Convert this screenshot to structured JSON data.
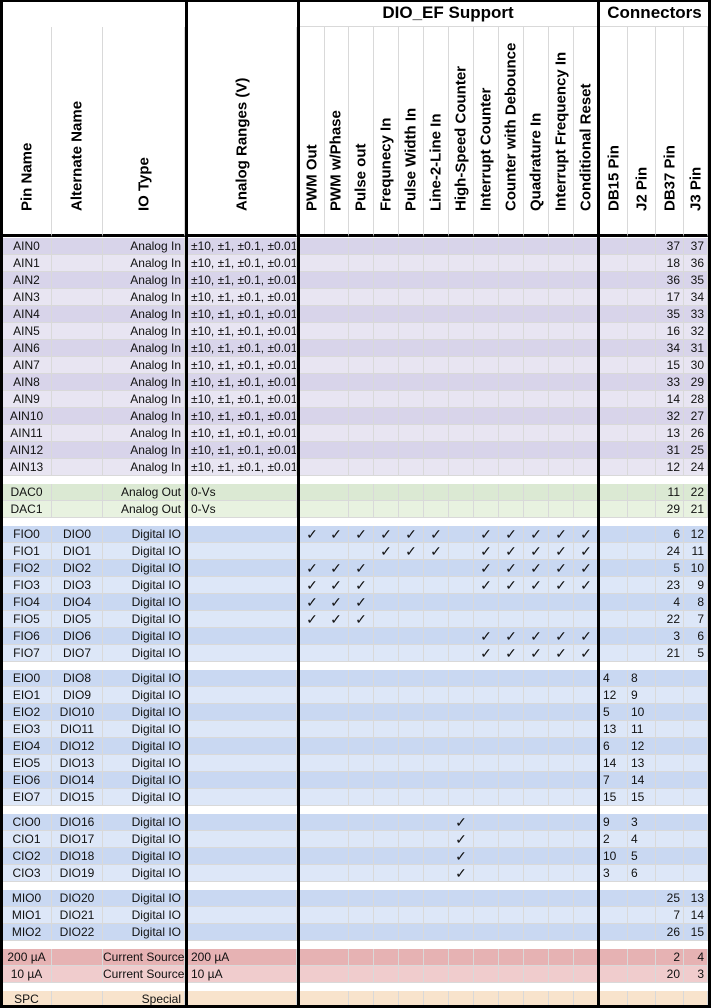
{
  "group_headers": {
    "dio_ef": "DIO_EF Support",
    "connectors": "Connectors"
  },
  "columns": {
    "pin_name": "Pin Name",
    "alternate_name": "Alternate Name",
    "io_type": "IO Type",
    "analog_ranges": "Analog Ranges (V)",
    "dio_ef": [
      "PWM Out",
      "PWM w/Phase",
      "Pulse out",
      "Frequnecy In",
      "Pulse Width In",
      "Line-2-Line In",
      "High-Speed Counter",
      "Interrupt Counter",
      "Counter with Debounce",
      "Quadrature In",
      "Interrupt Frequency In",
      "Conditional Reset"
    ],
    "connectors": [
      "DB15 Pin",
      "J2 Pin",
      "DB37 Pin",
      "J3 Pin"
    ]
  },
  "check_glyph": "✓",
  "colors": {
    "analog_in_dark": "#d8d4ea",
    "analog_in_light": "#e8e5f2",
    "analog_out_dark": "#dbe9d3",
    "analog_out_light": "#e8f2e0",
    "digital_dark": "#c9d8f2",
    "digital_light": "#dde7f8",
    "current_dark": "#e6b2b3",
    "current_light": "#f0cccd",
    "special": "#f8e3cc"
  },
  "groups": [
    {
      "color_key": "analog_in",
      "rows": [
        {
          "pin": "AIN0",
          "alt": "",
          "type": "Analog In",
          "range": "±10, ±1, ±0.1, ±0.01",
          "ef": [],
          "db15": "",
          "j2": "",
          "db37": "37",
          "j3": "37"
        },
        {
          "pin": "AIN1",
          "alt": "",
          "type": "Analog In",
          "range": "±10, ±1, ±0.1, ±0.01",
          "ef": [],
          "db15": "",
          "j2": "",
          "db37": "18",
          "j3": "36"
        },
        {
          "pin": "AIN2",
          "alt": "",
          "type": "Analog In",
          "range": "±10, ±1, ±0.1, ±0.01",
          "ef": [],
          "db15": "",
          "j2": "",
          "db37": "36",
          "j3": "35"
        },
        {
          "pin": "AIN3",
          "alt": "",
          "type": "Analog In",
          "range": "±10, ±1, ±0.1, ±0.01",
          "ef": [],
          "db15": "",
          "j2": "",
          "db37": "17",
          "j3": "34"
        },
        {
          "pin": "AIN4",
          "alt": "",
          "type": "Analog In",
          "range": "±10, ±1, ±0.1, ±0.01",
          "ef": [],
          "db15": "",
          "j2": "",
          "db37": "35",
          "j3": "33"
        },
        {
          "pin": "AIN5",
          "alt": "",
          "type": "Analog In",
          "range": "±10, ±1, ±0.1, ±0.01",
          "ef": [],
          "db15": "",
          "j2": "",
          "db37": "16",
          "j3": "32"
        },
        {
          "pin": "AIN6",
          "alt": "",
          "type": "Analog In",
          "range": "±10, ±1, ±0.1, ±0.01",
          "ef": [],
          "db15": "",
          "j2": "",
          "db37": "34",
          "j3": "31"
        },
        {
          "pin": "AIN7",
          "alt": "",
          "type": "Analog In",
          "range": "±10, ±1, ±0.1, ±0.01",
          "ef": [],
          "db15": "",
          "j2": "",
          "db37": "15",
          "j3": "30"
        },
        {
          "pin": "AIN8",
          "alt": "",
          "type": "Analog In",
          "range": "±10, ±1, ±0.1, ±0.01",
          "ef": [],
          "db15": "",
          "j2": "",
          "db37": "33",
          "j3": "29"
        },
        {
          "pin": "AIN9",
          "alt": "",
          "type": "Analog In",
          "range": "±10, ±1, ±0.1, ±0.01",
          "ef": [],
          "db15": "",
          "j2": "",
          "db37": "14",
          "j3": "28"
        },
        {
          "pin": "AIN10",
          "alt": "",
          "type": "Analog In",
          "range": "±10, ±1, ±0.1, ±0.01",
          "ef": [],
          "db15": "",
          "j2": "",
          "db37": "32",
          "j3": "27"
        },
        {
          "pin": "AIN11",
          "alt": "",
          "type": "Analog In",
          "range": "±10, ±1, ±0.1, ±0.01",
          "ef": [],
          "db15": "",
          "j2": "",
          "db37": "13",
          "j3": "26"
        },
        {
          "pin": "AIN12",
          "alt": "",
          "type": "Analog In",
          "range": "±10, ±1, ±0.1, ±0.01",
          "ef": [],
          "db15": "",
          "j2": "",
          "db37": "31",
          "j3": "25"
        },
        {
          "pin": "AIN13",
          "alt": "",
          "type": "Analog In",
          "range": "±10, ±1, ±0.1, ±0.01",
          "ef": [],
          "db15": "",
          "j2": "",
          "db37": "12",
          "j3": "24"
        }
      ]
    },
    {
      "color_key": "analog_out",
      "rows": [
        {
          "pin": "DAC0",
          "alt": "",
          "type": "Analog Out",
          "range": "0-Vs",
          "ef": [],
          "db15": "",
          "j2": "",
          "db37": "11",
          "j3": "22"
        },
        {
          "pin": "DAC1",
          "alt": "",
          "type": "Analog Out",
          "range": "0-Vs",
          "ef": [],
          "db15": "",
          "j2": "",
          "db37": "29",
          "j3": "21"
        }
      ]
    },
    {
      "color_key": "digital",
      "rows": [
        {
          "pin": "FIO0",
          "alt": "DIO0",
          "type": "Digital IO",
          "range": "",
          "ef": [
            0,
            1,
            2,
            3,
            4,
            5,
            7,
            8,
            9,
            10,
            11
          ],
          "db15": "",
          "j2": "",
          "db37": "6",
          "j3": "12"
        },
        {
          "pin": "FIO1",
          "alt": "DIO1",
          "type": "Digital IO",
          "range": "",
          "ef": [
            3,
            4,
            5,
            7,
            8,
            9,
            10,
            11
          ],
          "db15": "",
          "j2": "",
          "db37": "24",
          "j3": "11"
        },
        {
          "pin": "FIO2",
          "alt": "DIO2",
          "type": "Digital IO",
          "range": "",
          "ef": [
            0,
            1,
            2,
            7,
            8,
            9,
            10,
            11
          ],
          "db15": "",
          "j2": "",
          "db37": "5",
          "j3": "10"
        },
        {
          "pin": "FIO3",
          "alt": "DIO3",
          "type": "Digital IO",
          "range": "",
          "ef": [
            0,
            1,
            2,
            7,
            8,
            9,
            10,
            11
          ],
          "db15": "",
          "j2": "",
          "db37": "23",
          "j3": "9"
        },
        {
          "pin": "FIO4",
          "alt": "DIO4",
          "type": "Digital IO",
          "range": "",
          "ef": [
            0,
            1,
            2
          ],
          "db15": "",
          "j2": "",
          "db37": "4",
          "j3": "8"
        },
        {
          "pin": "FIO5",
          "alt": "DIO5",
          "type": "Digital IO",
          "range": "",
          "ef": [
            0,
            1,
            2
          ],
          "db15": "",
          "j2": "",
          "db37": "22",
          "j3": "7"
        },
        {
          "pin": "FIO6",
          "alt": "DIO6",
          "type": "Digital IO",
          "range": "",
          "ef": [
            7,
            8,
            9,
            10,
            11
          ],
          "db15": "",
          "j2": "",
          "db37": "3",
          "j3": "6"
        },
        {
          "pin": "FIO7",
          "alt": "DIO7",
          "type": "Digital IO",
          "range": "",
          "ef": [
            7,
            8,
            9,
            10,
            11
          ],
          "db15": "",
          "j2": "",
          "db37": "21",
          "j3": "5"
        }
      ]
    },
    {
      "color_key": "digital",
      "rows": [
        {
          "pin": "EIO0",
          "alt": "DIO8",
          "type": "Digital IO",
          "range": "",
          "ef": [],
          "db15": "4",
          "j2": "8",
          "db37": "",
          "j3": ""
        },
        {
          "pin": "EIO1",
          "alt": "DIO9",
          "type": "Digital IO",
          "range": "",
          "ef": [],
          "db15": "12",
          "j2": "9",
          "db37": "",
          "j3": ""
        },
        {
          "pin": "EIO2",
          "alt": "DIO10",
          "type": "Digital IO",
          "range": "",
          "ef": [],
          "db15": "5",
          "j2": "10",
          "db37": "",
          "j3": ""
        },
        {
          "pin": "EIO3",
          "alt": "DIO11",
          "type": "Digital IO",
          "range": "",
          "ef": [],
          "db15": "13",
          "j2": "11",
          "db37": "",
          "j3": ""
        },
        {
          "pin": "EIO4",
          "alt": "DIO12",
          "type": "Digital IO",
          "range": "",
          "ef": [],
          "db15": "6",
          "j2": "12",
          "db37": "",
          "j3": ""
        },
        {
          "pin": "EIO5",
          "alt": "DIO13",
          "type": "Digital IO",
          "range": "",
          "ef": [],
          "db15": "14",
          "j2": "13",
          "db37": "",
          "j3": ""
        },
        {
          "pin": "EIO6",
          "alt": "DIO14",
          "type": "Digital IO",
          "range": "",
          "ef": [],
          "db15": "7",
          "j2": "14",
          "db37": "",
          "j3": ""
        },
        {
          "pin": "EIO7",
          "alt": "DIO15",
          "type": "Digital IO",
          "range": "",
          "ef": [],
          "db15": "15",
          "j2": "15",
          "db37": "",
          "j3": ""
        }
      ]
    },
    {
      "color_key": "digital",
      "rows": [
        {
          "pin": "CIO0",
          "alt": "DIO16",
          "type": "Digital IO",
          "range": "",
          "ef": [
            6
          ],
          "db15": "9",
          "j2": "3",
          "db37": "",
          "j3": ""
        },
        {
          "pin": "CIO1",
          "alt": "DIO17",
          "type": "Digital IO",
          "range": "",
          "ef": [
            6
          ],
          "db15": "2",
          "j2": "4",
          "db37": "",
          "j3": ""
        },
        {
          "pin": "CIO2",
          "alt": "DIO18",
          "type": "Digital IO",
          "range": "",
          "ef": [
            6
          ],
          "db15": "10",
          "j2": "5",
          "db37": "",
          "j3": ""
        },
        {
          "pin": "CIO3",
          "alt": "DIO19",
          "type": "Digital IO",
          "range": "",
          "ef": [
            6
          ],
          "db15": "3",
          "j2": "6",
          "db37": "",
          "j3": ""
        }
      ]
    },
    {
      "color_key": "digital",
      "rows": [
        {
          "pin": "MIO0",
          "alt": "DIO20",
          "type": "Digital IO",
          "range": "",
          "ef": [],
          "db15": "",
          "j2": "",
          "db37": "25",
          "j3": "13"
        },
        {
          "pin": "MIO1",
          "alt": "DIO21",
          "type": "Digital IO",
          "range": "",
          "ef": [],
          "db15": "",
          "j2": "",
          "db37": "7",
          "j3": "14"
        },
        {
          "pin": "MIO2",
          "alt": "DIO22",
          "type": "Digital IO",
          "range": "",
          "ef": [],
          "db15": "",
          "j2": "",
          "db37": "26",
          "j3": "15"
        }
      ]
    },
    {
      "color_key": "current",
      "rows": [
        {
          "pin": "200 µA",
          "alt": "",
          "type": "Current Source",
          "range": "200 µA",
          "ef": [],
          "db15": "",
          "j2": "",
          "db37": "2",
          "j3": "4"
        },
        {
          "pin": "10 µA",
          "alt": "",
          "type": "Current Source",
          "range": "10 µA",
          "ef": [],
          "db15": "",
          "j2": "",
          "db37": "20",
          "j3": "3"
        }
      ]
    },
    {
      "color_key": "special",
      "rows": [
        {
          "pin": "SPC",
          "alt": "",
          "type": "Special",
          "range": "",
          "ef": [],
          "db15": "",
          "j2": "",
          "db37": "",
          "j3": ""
        }
      ]
    }
  ]
}
